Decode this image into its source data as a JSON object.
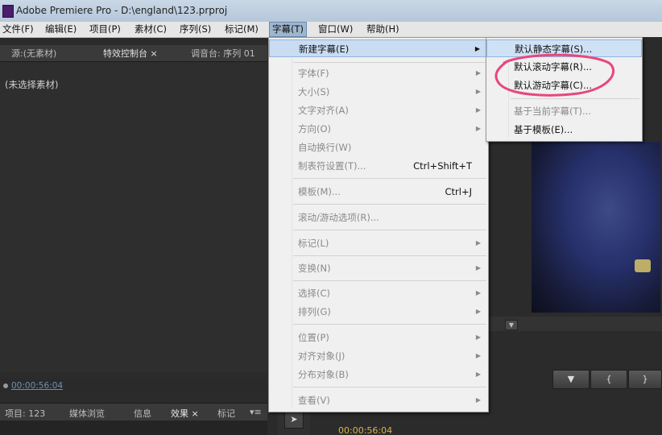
{
  "window": {
    "title": "Adobe Premiere Pro - D:\\england\\123.prproj"
  },
  "menubar": {
    "items": [
      {
        "label": "文件(F)"
      },
      {
        "label": "编辑(E)"
      },
      {
        "label": "项目(P)"
      },
      {
        "label": "素材(C)"
      },
      {
        "label": "序列(S)"
      },
      {
        "label": "标记(M)"
      },
      {
        "label": "字幕(T)"
      },
      {
        "label": "窗口(W)"
      },
      {
        "label": "帮助(H)"
      }
    ]
  },
  "left_panel": {
    "tabs": [
      {
        "label": "源:(无素材)"
      },
      {
        "label": "特效控制台 ×"
      },
      {
        "label": "调音台: 序列 01"
      }
    ],
    "empty_text": "(未选择素材)",
    "timecode": "00:00:56:04"
  },
  "bottom_panel": {
    "tabs": [
      {
        "label": "项目: 123"
      },
      {
        "label": "媒体浏览"
      },
      {
        "label": "信息"
      },
      {
        "label": "效果 ×"
      },
      {
        "label": "标记"
      }
    ]
  },
  "title_menu": {
    "items": [
      {
        "label": "新建字幕(E)",
        "shortcut": "",
        "submenu": true,
        "disabled": false,
        "highlighted": true
      },
      {
        "label": "字体(F)",
        "shortcut": "",
        "submenu": true,
        "disabled": true
      },
      {
        "label": "大小(S)",
        "shortcut": "",
        "submenu": true,
        "disabled": true
      },
      {
        "label": "文字对齐(A)",
        "shortcut": "",
        "submenu": true,
        "disabled": true
      },
      {
        "label": "方向(O)",
        "shortcut": "",
        "submenu": true,
        "disabled": true
      },
      {
        "label": "自动换行(W)",
        "shortcut": "",
        "submenu": false,
        "disabled": true
      },
      {
        "label": "制表符设置(T)...",
        "shortcut": "Ctrl+Shift+T",
        "submenu": false,
        "disabled": true
      },
      {
        "label": "模板(M)...",
        "shortcut": "Ctrl+J",
        "submenu": false,
        "disabled": true
      },
      {
        "label": "滚动/游动选项(R)...",
        "shortcut": "",
        "submenu": false,
        "disabled": true
      },
      {
        "label": "标记(L)",
        "shortcut": "",
        "submenu": true,
        "disabled": true
      },
      {
        "label": "变换(N)",
        "shortcut": "",
        "submenu": true,
        "disabled": true
      },
      {
        "label": "选择(C)",
        "shortcut": "",
        "submenu": true,
        "disabled": true
      },
      {
        "label": "排列(G)",
        "shortcut": "",
        "submenu": true,
        "disabled": true
      },
      {
        "label": "位置(P)",
        "shortcut": "",
        "submenu": true,
        "disabled": true
      },
      {
        "label": "对齐对象(J)",
        "shortcut": "",
        "submenu": true,
        "disabled": true
      },
      {
        "label": "分布对象(B)",
        "shortcut": "",
        "submenu": true,
        "disabled": true
      },
      {
        "label": "查看(V)",
        "shortcut": "",
        "submenu": true,
        "disabled": true
      }
    ]
  },
  "new_title_submenu": {
    "items": [
      {
        "label": "默认静态字幕(S)...",
        "disabled": false,
        "highlighted": true
      },
      {
        "label": "默认滚动字幕(R)...",
        "disabled": false
      },
      {
        "label": "默认游动字幕(C)...",
        "disabled": false
      },
      {
        "label": "基于当前字幕(T)...",
        "disabled": true
      },
      {
        "label": "基于模板(E)...",
        "disabled": false
      }
    ]
  },
  "annotation_color": "#e8467c",
  "program_timecode": "00:00:56:04"
}
